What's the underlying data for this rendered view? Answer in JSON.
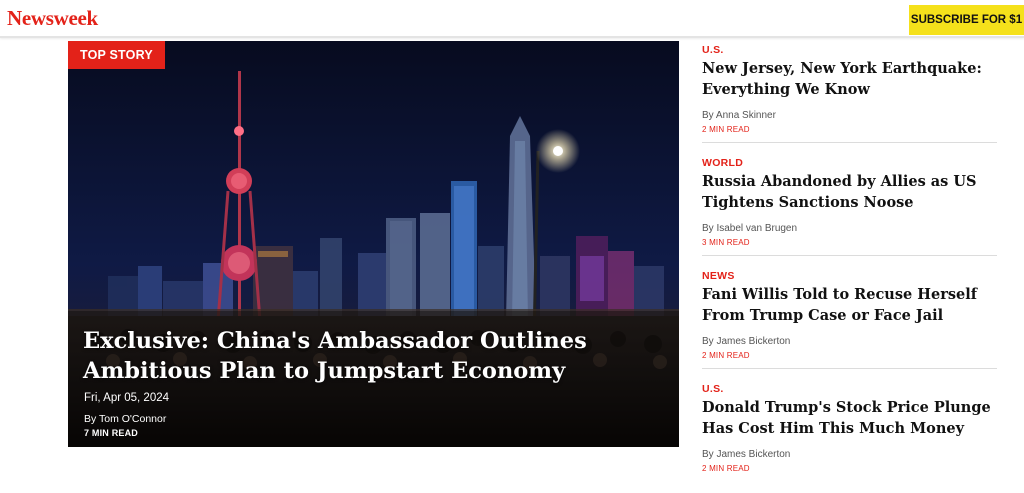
{
  "brand": {
    "logo_text": "Newsweek",
    "accent": "#e32219"
  },
  "header": {
    "subscribe_label": "SUBSCRIBE FOR $1",
    "subscribe_color": "#f5e11b"
  },
  "top_story": {
    "badge": "TOP STORY",
    "title": "Exclusive: China's Ambassador Outlines Ambitious Plan to Jumpstart Economy",
    "date": "Fri, Apr 05, 2024",
    "author": "By Tom O'Connor",
    "read_time": "7 MIN READ",
    "image_alt": "Shanghai skyline at night with crowd in foreground"
  },
  "sidebar": {
    "items": [
      {
        "category": "U.S.",
        "headline": "New Jersey, New York Earthquake: Everything We Know",
        "author": "By Anna Skinner",
        "read_time": "2 MIN READ"
      },
      {
        "category": "WORLD",
        "headline": "Russia Abandoned by Allies as US Tightens Sanctions Noose",
        "author": "By Isabel van Brugen",
        "read_time": "3 MIN READ"
      },
      {
        "category": "NEWS",
        "headline": "Fani Willis Told to Recuse Herself From Trump Case or Face Jail",
        "author": "By James Bickerton",
        "read_time": "2 MIN READ"
      },
      {
        "category": "U.S.",
        "headline": "Donald Trump's Stock Price Plunge Has Cost Him This Much Money",
        "author": "By James Bickerton",
        "read_time": "2 MIN READ"
      }
    ]
  }
}
